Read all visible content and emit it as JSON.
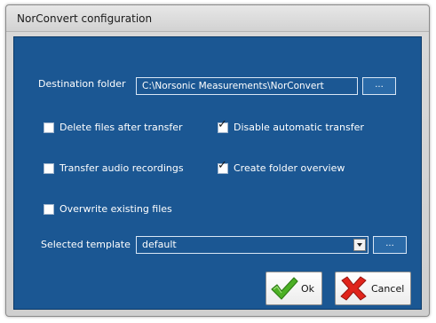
{
  "window": {
    "title": "NorConvert configuration"
  },
  "colors": {
    "panel_background": "#1b5793",
    "panel_text": "#ffffff",
    "ok_icon": "#4cb025",
    "cancel_icon": "#e0241b"
  },
  "destination": {
    "label": "Destination folder",
    "value": "C:\\Norsonic Measurements\\NorConvert",
    "browse_label": "..."
  },
  "options": {
    "delete_files": {
      "label": "Delete files after transfer",
      "checked": false
    },
    "disable_transfer": {
      "label": "Disable automatic transfer",
      "checked": true
    },
    "transfer_audio": {
      "label": "Transfer audio recordings",
      "checked": false
    },
    "create_overview": {
      "label": "Create folder overview",
      "checked": true
    },
    "overwrite_files": {
      "label": "Overwrite existing files",
      "checked": false
    }
  },
  "template": {
    "label": "Selected template",
    "value": "default",
    "browse_label": "..."
  },
  "buttons": {
    "ok_label": "Ok",
    "cancel_label": "Cancel",
    "ok_icon": "checkmark-icon",
    "cancel_icon": "x-icon"
  }
}
